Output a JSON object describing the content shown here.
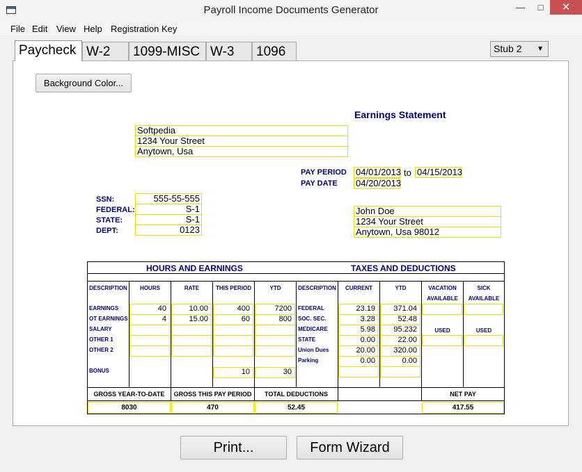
{
  "window": {
    "title": "Payroll Income Documents Generator",
    "minimize": "—",
    "maximize": "□",
    "close": "✕"
  },
  "menu": [
    "File",
    "Edit",
    "View",
    "Help",
    "Registration Key"
  ],
  "tabs": [
    "Paycheck",
    "W-2",
    "1099-MISC",
    "W-3",
    "1096"
  ],
  "active_tab": "Paycheck",
  "stub_select": {
    "value": "Stub 2",
    "arrow": "▼"
  },
  "background_button": "Background Color...",
  "statement_title": "Earnings Statement",
  "company": [
    "Softpedia",
    "1234 Your Street",
    "Anytown, Usa"
  ],
  "pay_period": {
    "label": "PAY PERIOD",
    "from": "04/01/2013",
    "to_label": "to",
    "to": "04/15/2013"
  },
  "pay_date": {
    "label": "PAY DATE",
    "value": "04/20/2013"
  },
  "employee_info": {
    "labels": [
      "SSN:",
      "FEDERAL:",
      "STATE:",
      "DEPT:"
    ],
    "values": [
      "555-55-555",
      "S-1",
      "S-1",
      "0123"
    ]
  },
  "employee_address": [
    "John Doe",
    "1234 Your Street",
    "Anytown, Usa 98012"
  ],
  "table": {
    "section_hours": "HOURS AND EARNINGS",
    "section_taxes": "TAXES AND DEDUCTIONS",
    "col_headers": [
      "DESCRIPTION",
      "HOURS",
      "RATE",
      "THIS PERIOD",
      "YTD",
      "DESCRIPTION",
      "CURRENT",
      "YTD",
      "VACATION",
      "SICK"
    ],
    "available": [
      "AVAILABLE",
      "AVAILABLE"
    ],
    "earnings_rows": [
      {
        "label": "EARNINGS",
        "hours": "40",
        "rate": "10.00",
        "period": "400",
        "ytd": "7200"
      },
      {
        "label": "OT EARNINGS",
        "hours": "4",
        "rate": "15.00",
        "period": "60",
        "ytd": "800"
      },
      {
        "label": "SALARY",
        "hours": "",
        "rate": "",
        "period": "",
        "ytd": ""
      },
      {
        "label": "OTHER 1",
        "hours": "",
        "rate": "",
        "period": "",
        "ytd": ""
      },
      {
        "label": "OTHER 2",
        "hours": "",
        "rate": "",
        "period": "",
        "ytd": ""
      },
      {
        "label": "BONUS",
        "hours": "",
        "rate": "",
        "period": "10",
        "ytd": "30"
      }
    ],
    "deduction_rows": [
      {
        "label": "FEDERAL",
        "current": "23.19",
        "ytd": "371.04"
      },
      {
        "label": "SOC. SEC.",
        "current": "3.28",
        "ytd": "52.48"
      },
      {
        "label": "MEDICARE",
        "current": "5.98",
        "ytd": "95.232"
      },
      {
        "label": "STATE",
        "current": "0.00",
        "ytd": "22.00"
      },
      {
        "label": "Union Dues",
        "current": "20.00",
        "ytd": "320.00"
      },
      {
        "label": "Parking",
        "current": "0.00",
        "ytd": "0.00"
      }
    ],
    "used": [
      "USED",
      "USED"
    ],
    "totals": {
      "gross_ytd_label": "GROSS YEAR-TO-DATE",
      "gross_ytd": "8030",
      "gross_period_label": "GROSS THIS PAY PERIOD",
      "gross_period": "470",
      "total_ded_label": "TOTAL DEDUCTIONS",
      "total_ded": "52.45",
      "net_pay_label": "NET PAY",
      "net_pay": "417.55"
    }
  },
  "print_button": "Print...",
  "wizard_button": "Form Wizard"
}
